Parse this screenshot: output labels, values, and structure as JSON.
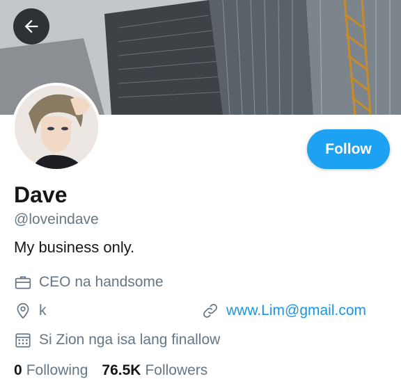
{
  "profile": {
    "name": "Dave",
    "handle": "@loveindave",
    "bio": "My business only."
  },
  "actions": {
    "follow_label": "Follow"
  },
  "meta": {
    "job": "CEO na handsome",
    "location": "k",
    "website": "www.Lim@gmail.com",
    "joined": "Si Zion nga isa lang finallow"
  },
  "stats": {
    "following_count": "0",
    "following_label": "Following",
    "followers_count": "76.5K",
    "followers_label": "Followers"
  },
  "icons": {
    "back": "arrow-left-icon",
    "job": "briefcase-icon",
    "location": "location-pin-icon",
    "website": "link-icon",
    "joined": "calendar-icon"
  },
  "colors": {
    "accent": "#1da1f2",
    "link": "#1b95e0",
    "secondary_text": "#657786",
    "primary_text": "#14171a"
  }
}
